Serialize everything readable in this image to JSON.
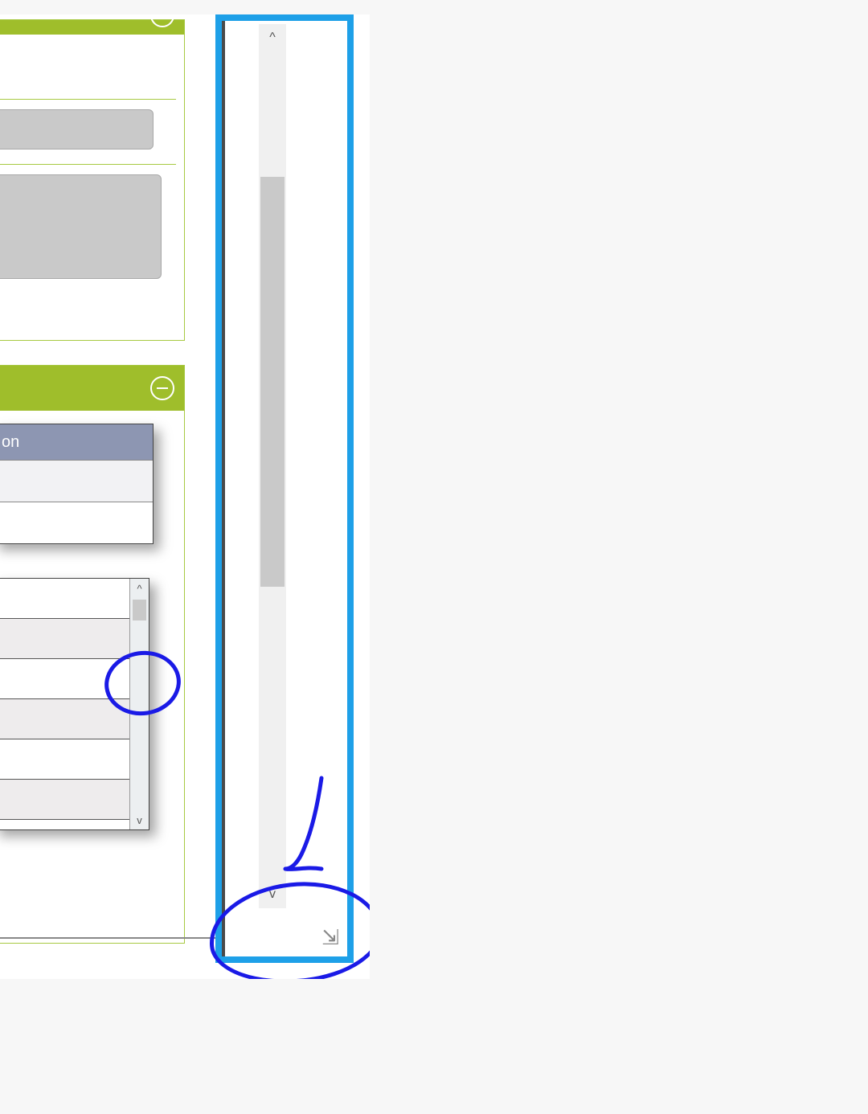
{
  "colors": {
    "highlight_box": "#1ea0e8",
    "annotation_ink": "#1a1ae6",
    "panel_accent": "#9fbe2b",
    "panel_border": "#a7c941",
    "table_header_bg": "#8d96b2"
  },
  "panel1": {
    "collapse_icon": "minus-icon"
  },
  "panel2": {
    "collapse_icon": "minus-icon",
    "table": {
      "header_fragment": "on",
      "rows": 2
    }
  },
  "list": {
    "rows": 6,
    "inner_scroll": {
      "up_glyph": "^",
      "down_glyph": "v"
    }
  },
  "main_scroll": {
    "up_glyph": "^",
    "down_glyph": "v",
    "resize_glyph": "⇲"
  }
}
